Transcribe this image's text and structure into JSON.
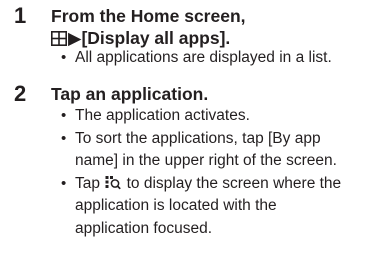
{
  "steps": [
    {
      "number": "1",
      "heading_line1": "From the Home screen,",
      "heading_line2_icon": "grid-apps-icon",
      "heading_line2_arrow": "▶",
      "heading_line2_text": "[Display all apps].",
      "bullets": [
        "All applications are displayed in a list."
      ]
    },
    {
      "number": "2",
      "heading": "Tap an application.",
      "bullets": [
        "The application activates.",
        "To sort the applications, tap [By app",
        "name] in the upper right of the screen.",
        "Tap",
        "to display the screen where the",
        "application is located with the",
        "application focused."
      ],
      "bullet_icon": "locate-app-icon"
    }
  ],
  "bullet_char": "•",
  "colors": {
    "text": "#231f20",
    "icon": "#231f20"
  }
}
